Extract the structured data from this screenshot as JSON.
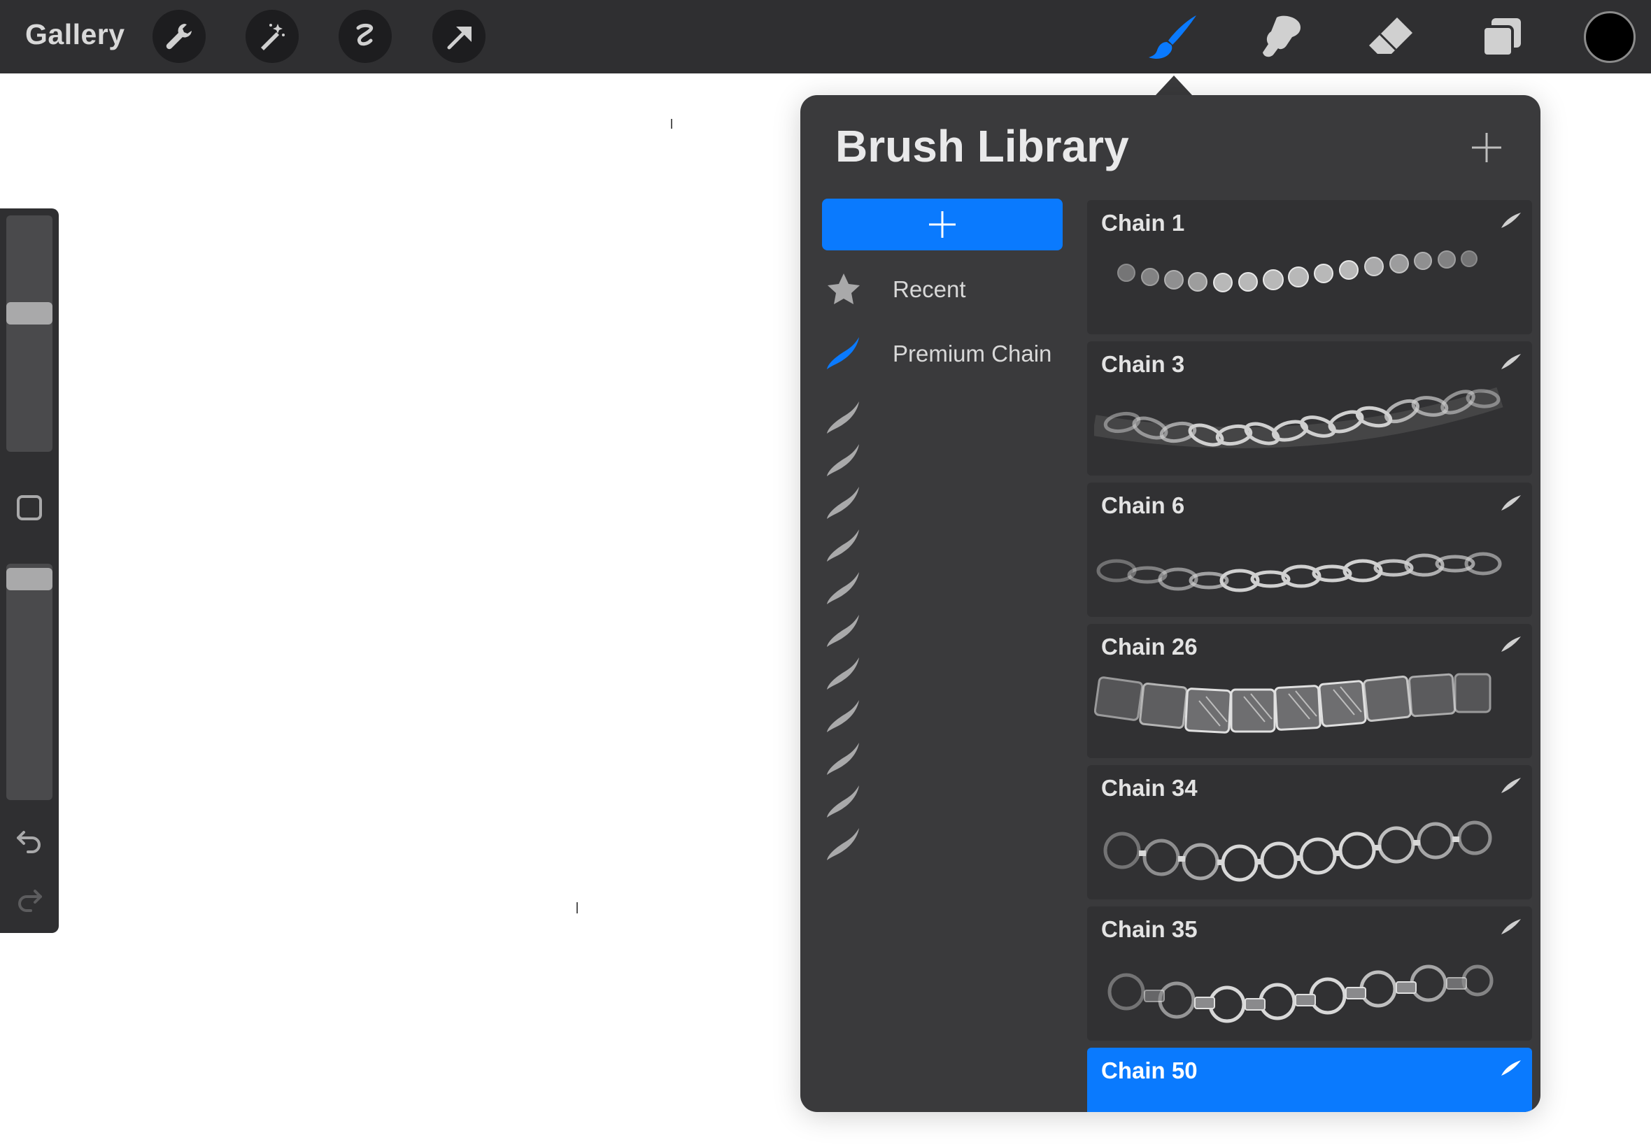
{
  "topbar": {
    "gallery_label": "Gallery",
    "left_tools": [
      "wrench-icon",
      "magic-wand-icon",
      "selection-icon",
      "move-arrow-icon"
    ],
    "right_tools": [
      "brush-icon",
      "smudge-icon",
      "eraser-icon",
      "layers-icon"
    ],
    "active_tool": "brush",
    "current_color": "#000000"
  },
  "brush_library": {
    "title": "Brush Library",
    "sets": [
      {
        "label": "Recent",
        "icon": "star-icon"
      },
      {
        "label": "Premium Chain",
        "icon": "brush-stroke-icon",
        "active": true
      },
      {
        "label": "",
        "icon": "brush-stroke-icon"
      },
      {
        "label": "",
        "icon": "brush-stroke-icon"
      },
      {
        "label": "",
        "icon": "brush-stroke-icon"
      },
      {
        "label": "",
        "icon": "brush-stroke-icon"
      },
      {
        "label": "",
        "icon": "brush-stroke-icon"
      },
      {
        "label": "",
        "icon": "brush-stroke-icon"
      },
      {
        "label": "",
        "icon": "brush-stroke-icon"
      },
      {
        "label": "",
        "icon": "brush-stroke-icon"
      },
      {
        "label": "",
        "icon": "brush-stroke-icon"
      },
      {
        "label": "",
        "icon": "brush-stroke-icon"
      },
      {
        "label": "",
        "icon": "brush-stroke-icon"
      }
    ],
    "brushes": [
      {
        "name": "Chain 1",
        "style": "beads"
      },
      {
        "name": "Chain 3",
        "style": "curb"
      },
      {
        "name": "Chain 6",
        "style": "cable"
      },
      {
        "name": "Chain 26",
        "style": "plates"
      },
      {
        "name": "Chain 34",
        "style": "rings"
      },
      {
        "name": "Chain 35",
        "style": "rings-bar"
      },
      {
        "name": "Chain 50",
        "style": "selected",
        "selected": true
      }
    ]
  },
  "sidebar": {
    "brush_size_level": 0.6,
    "opacity_level": 0.96,
    "modify_button": "square-icon",
    "undo": "undo-icon",
    "redo": "redo-icon"
  },
  "colors": {
    "accent": "#0a7afe",
    "toolbar": "#2f2f31",
    "panel": "#3a3a3c",
    "card": "#313133"
  }
}
